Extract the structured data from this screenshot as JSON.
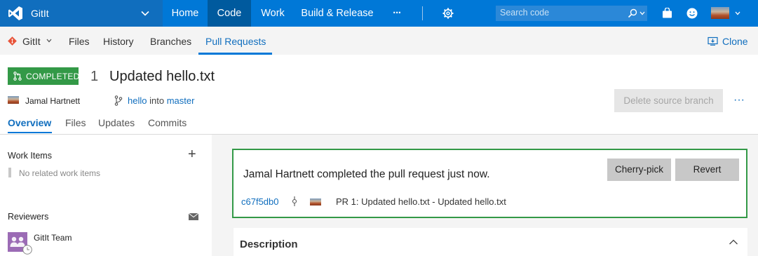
{
  "app": {
    "project_name": "GitIt",
    "brand_color": "#0078d7"
  },
  "topnav": {
    "items": [
      "Home",
      "Code",
      "Work",
      "Build & Release"
    ],
    "active": "Code",
    "more": "···",
    "search_placeholder": "Search code"
  },
  "subnav": {
    "repo": "GitIt",
    "items": [
      "Files",
      "History",
      "Branches",
      "Pull Requests"
    ],
    "active": "Pull Requests",
    "clone_label": "Clone"
  },
  "pr": {
    "status": "COMPLETED",
    "status_color": "#339947",
    "number": "1",
    "title": "Updated hello.txt",
    "author": "Jamal Hartnett",
    "source_branch": "hello",
    "into_text": "into",
    "target_branch": "master",
    "delete_branch_label": "Delete source branch",
    "more": "···",
    "tabs": [
      "Overview",
      "Files",
      "Updates",
      "Commits"
    ],
    "active_tab": "Overview"
  },
  "sidebar": {
    "work_items_title": "Work Items",
    "no_work_items": "No related work items",
    "reviewers_title": "Reviewers",
    "reviewers": [
      {
        "name": "GitIt Team"
      }
    ]
  },
  "completion": {
    "message": "Jamal Hartnett completed the pull request just now.",
    "cherry_pick_label": "Cherry-pick",
    "revert_label": "Revert",
    "commit_id": "c67f5db0",
    "commit_message": "PR 1: Updated hello.txt - Updated hello.txt"
  },
  "description": {
    "title": "Description"
  }
}
